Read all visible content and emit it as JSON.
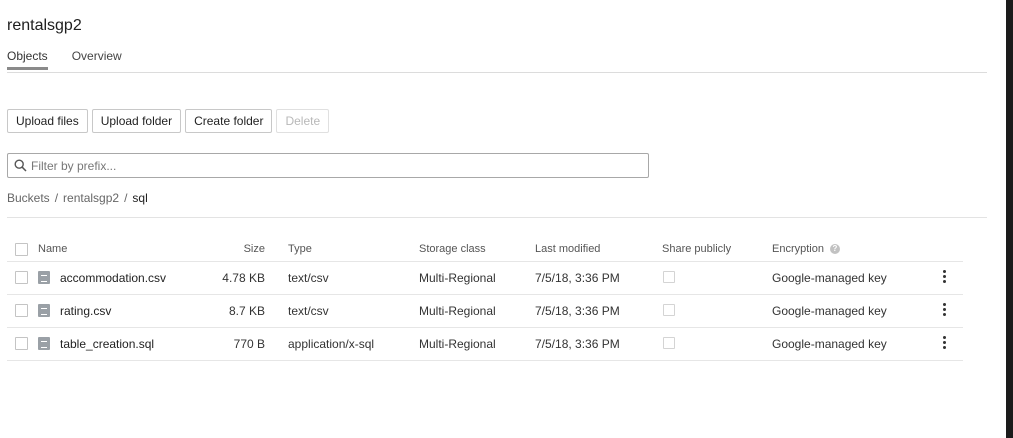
{
  "bucket_title": "rentalsgp2",
  "tabs": [
    "Objects",
    "Overview"
  ],
  "toolbar": {
    "upload_files": "Upload files",
    "upload_folder": "Upload folder",
    "create_folder": "Create folder",
    "delete": "Delete"
  },
  "filter": {
    "placeholder": "Filter by prefix..."
  },
  "breadcrumb": {
    "root": "Buckets",
    "bucket": "rentalsgp2",
    "folder": "sql",
    "separator": "/"
  },
  "columns": {
    "name": "Name",
    "size": "Size",
    "type": "Type",
    "storage": "Storage class",
    "modified": "Last modified",
    "share": "Share publicly",
    "encryption": "Encryption"
  },
  "files": [
    {
      "name": "accommodation.csv",
      "size": "4.78 KB",
      "type": "text/csv",
      "storage": "Multi-Regional",
      "modified": "7/5/18, 3:36 PM",
      "encryption": "Google-managed key"
    },
    {
      "name": "rating.csv",
      "size": "8.7 KB",
      "type": "text/csv",
      "storage": "Multi-Regional",
      "modified": "7/5/18, 3:36 PM",
      "encryption": "Google-managed key"
    },
    {
      "name": "table_creation.sql",
      "size": "770 B",
      "type": "application/x-sql",
      "storage": "Multi-Regional",
      "modified": "7/5/18, 3:36 PM",
      "encryption": "Google-managed key"
    }
  ],
  "icons": {
    "search": "search-icon",
    "file": "file-icon",
    "help": "help-icon",
    "more": "more-vert-icon"
  },
  "colors": {
    "tab_underline": "#8a8a8a",
    "file_icon": "#9aa0a6"
  }
}
